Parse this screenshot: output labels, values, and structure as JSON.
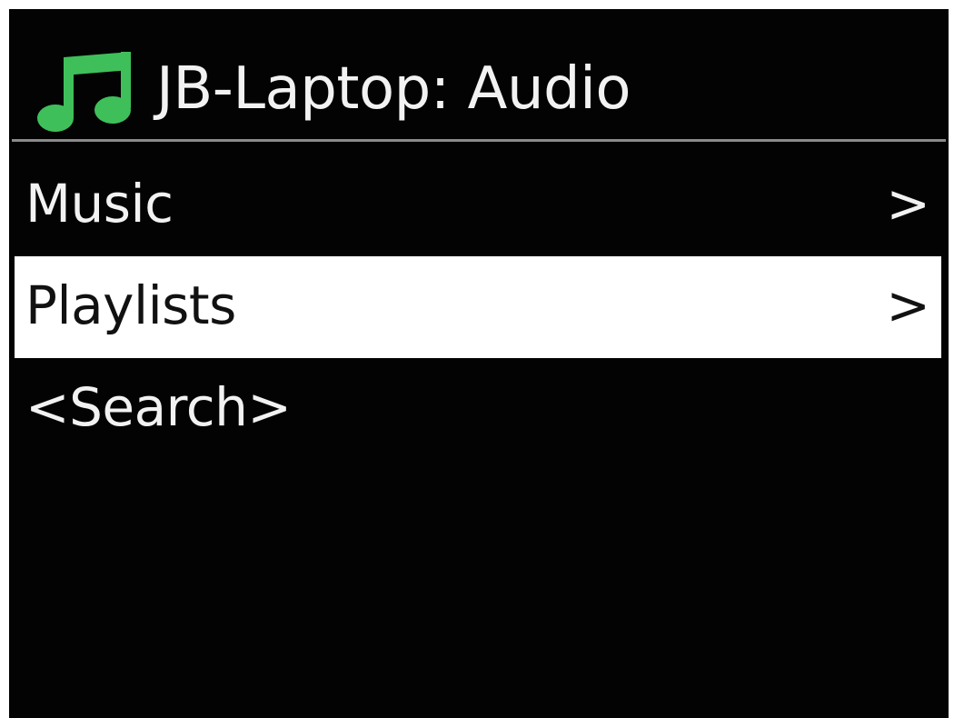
{
  "header": {
    "icon": "music-note-icon",
    "icon_color": "#3fbf5a",
    "title": "JB-Laptop: Audio"
  },
  "menu": {
    "selected_index": 1,
    "items": [
      {
        "label": "Music",
        "chevron": ">"
      },
      {
        "label": "Playlists",
        "chevron": ">"
      },
      {
        "label": "<Search>",
        "chevron": ""
      }
    ]
  },
  "colors": {
    "background": "#030303",
    "text": "#f2f2f2",
    "highlight_bg": "#ffffff",
    "highlight_text": "#111111",
    "divider": "#8a8a8a"
  }
}
